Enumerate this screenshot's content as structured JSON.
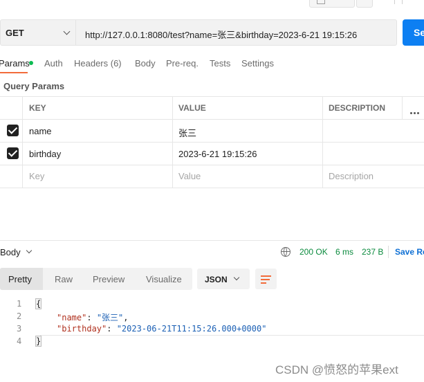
{
  "request": {
    "method": "GET",
    "url": "http://127.0.0.1:8080/test?name=张三&birthday=2023-6-21 19:15:26",
    "send_label": "Se"
  },
  "tabs": [
    {
      "label": "Params",
      "active": true
    },
    {
      "label": "Auth"
    },
    {
      "label": "Headers (6)"
    },
    {
      "label": "Body"
    },
    {
      "label": "Pre-req."
    },
    {
      "label": "Tests"
    },
    {
      "label": "Settings"
    }
  ],
  "query_params": {
    "title": "Query Params",
    "columns": [
      "KEY",
      "VALUE",
      "DESCRIPTION"
    ],
    "rows": [
      {
        "key": "name",
        "value": "张三",
        "checked": true
      },
      {
        "key": "birthday",
        "value": "2023-6-21 19:15:26",
        "checked": true
      }
    ],
    "placeholder": {
      "key": "Key",
      "value": "Value",
      "description": "Description"
    }
  },
  "response": {
    "body_label": "Body",
    "status": "200 OK",
    "time": "6 ms",
    "size": "237 B",
    "save_label": "Save Re",
    "view_tabs": [
      "Pretty",
      "Raw",
      "Preview",
      "Visualize"
    ],
    "active_view": "Pretty",
    "format": "JSON",
    "code": {
      "line_numbers": [
        "1",
        "2",
        "3",
        "4"
      ],
      "open": "{",
      "close": "}",
      "fields": [
        {
          "key": "\"name\"",
          "value": "\"张三\"",
          "trail": ","
        },
        {
          "key": "\"birthday\"",
          "value": "\"2023-06-21T11:15:26.000+0000\"",
          "trail": ""
        }
      ]
    }
  },
  "watermark": "CSDN @愤怒的苹果ext",
  "colors": {
    "accent": "#f26b3a",
    "send": "#0d7ff2",
    "status_ok": "#0a8a3d",
    "link": "#0d6fd4"
  }
}
